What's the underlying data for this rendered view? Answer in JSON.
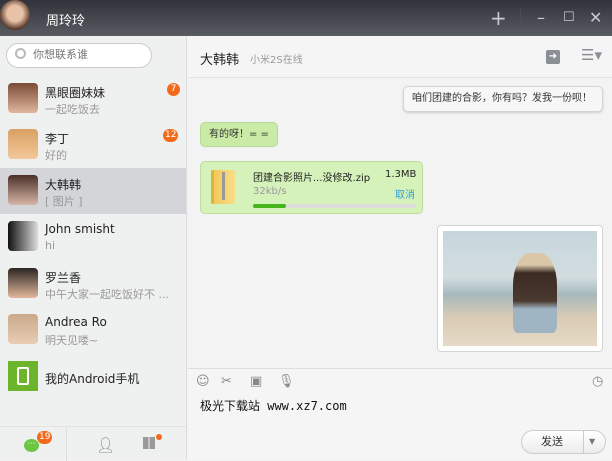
{
  "titlebar": {
    "user_name": "周玲玲"
  },
  "search": {
    "placeholder": "你想联系谁"
  },
  "contacts": [
    {
      "name": "黑眼圈妹妹",
      "last": "一起吃饭去",
      "badge": "7"
    },
    {
      "name": "李丁",
      "last": "好的",
      "badge": "12"
    },
    {
      "name": "大韩韩",
      "last": "[ 图片 ]"
    },
    {
      "name": "John smisht",
      "last": "hi"
    },
    {
      "name": "罗兰香",
      "last": "中午大家一起吃饭好不 ..."
    },
    {
      "name": "Andrea Ro",
      "last": "明天见喽~"
    },
    {
      "name": "我的Android手机"
    }
  ],
  "bottom_nav": {
    "chat_badge": "19"
  },
  "chat": {
    "name": "大韩韩",
    "status": "小米2S在线",
    "messages": [
      {
        "side": "right",
        "text": "咱们团建的合影，你有吗？发我一份呗！"
      },
      {
        "side": "left",
        "text": "有的呀！= ="
      }
    ],
    "file": {
      "name": "团建合影照片...没修改.zip",
      "size": "1.3MB",
      "speed": "32kb/s",
      "cancel": "取消",
      "progress": 0.2
    }
  },
  "composer": {
    "text": "极光下载站 www.xz7.com",
    "send": "发送"
  },
  "colors": {
    "accent": "#6cc644",
    "badge": "#f26b1d",
    "link": "#2e9fd8"
  }
}
